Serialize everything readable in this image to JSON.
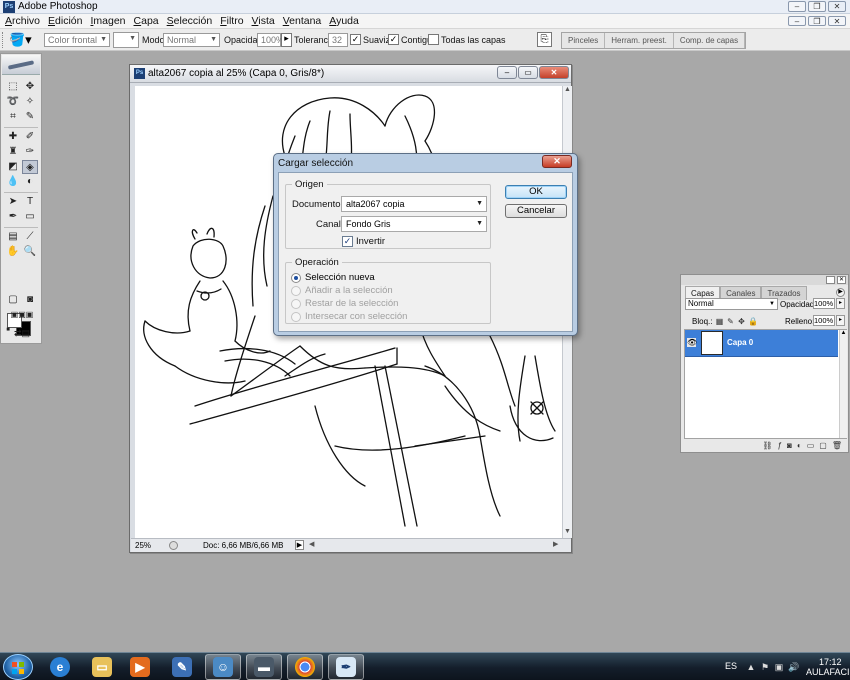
{
  "app": {
    "title": "Adobe Photoshop",
    "logo": "Ps",
    "window_buttons": [
      "minimize-icon",
      "restore-icon",
      "close-icon"
    ]
  },
  "menu": [
    "Archivo",
    "Edición",
    "Imagen",
    "Capa",
    "Selección",
    "Filtro",
    "Vista",
    "Ventana",
    "Ayuda"
  ],
  "options_bar": {
    "fill_source": "Color frontal",
    "mode_label": "Modo:",
    "mode_value": "Normal",
    "opacity_label": "Opacidad:",
    "opacity_value": "100%",
    "tolerance_label": "Tolerancia:",
    "tolerance_value": "32",
    "antialias_label": "Suavizar",
    "antialias_checked": true,
    "contiguous_label": "Contiguo",
    "contiguous_checked": true,
    "all_layers_label": "Todas las capas",
    "all_layers_checked": false,
    "palette_tabs": [
      "Pinceles",
      "Herram. preest.",
      "Comp. de capas"
    ]
  },
  "document": {
    "title": "alta2067 copia al 25% (Capa 0, Gris/8*)",
    "zoom": "25%",
    "doc_info": "Doc: 6,66 MB/6,66 MB"
  },
  "dialog": {
    "title": "Cargar selección",
    "source_group": "Origen",
    "document_label": "Documento:",
    "document_value": "alta2067 copia",
    "channel_label": "Canal:",
    "channel_value": "Fondo Gris",
    "invert_label": "Invertir",
    "invert_checked": true,
    "operation_group": "Operación",
    "operations": [
      {
        "label": "Selección nueva",
        "selected": true,
        "enabled": true
      },
      {
        "label": "Añadir a la selección",
        "selected": false,
        "enabled": false
      },
      {
        "label": "Restar de la selección",
        "selected": false,
        "enabled": false
      },
      {
        "label": "Intersecar con selección",
        "selected": false,
        "enabled": false
      }
    ],
    "ok_label": "OK",
    "cancel_label": "Cancelar"
  },
  "layers_panel": {
    "tabs": [
      "Capas",
      "Canales",
      "Trazados"
    ],
    "active_tab": "Capas",
    "blend_mode": "Normal",
    "opacity_label": "Opacidad:",
    "opacity_value": "100%",
    "lock_label": "Bloq.:",
    "fill_label": "Relleno:",
    "fill_value": "100%",
    "layers": [
      {
        "name": "Capa 0",
        "visible": true,
        "selected": true
      }
    ]
  },
  "taskbar": {
    "apps": [
      "windows-explorer",
      "internet-explorer",
      "file-explorer",
      "media-player",
      "app-5",
      "app-6",
      "app-7",
      "chrome",
      "photoshop"
    ],
    "language": "ES",
    "time": "17:12",
    "date": "AULAFACIL"
  },
  "colors": {
    "workspace": "#a8a8a8",
    "dialog_frame": "#b9cde3",
    "layer_selected": "#3d7fd8"
  }
}
